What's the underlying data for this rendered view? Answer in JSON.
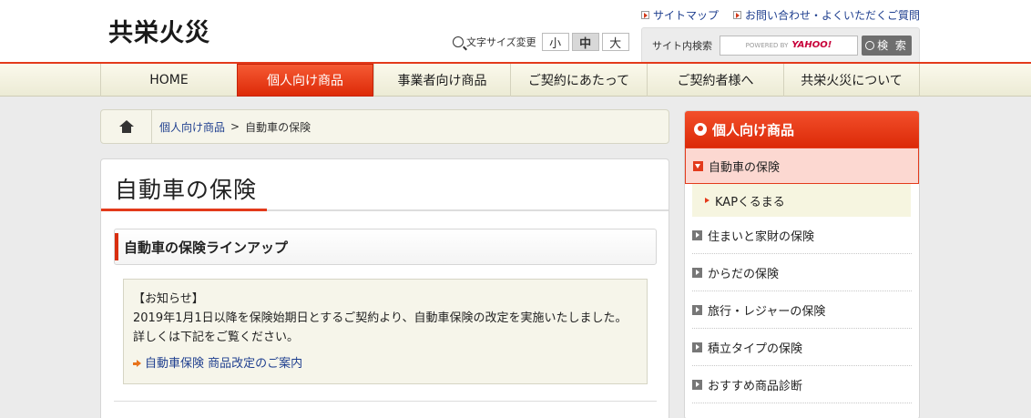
{
  "header": {
    "logo": "共栄火災",
    "top_links": [
      "サイトマップ",
      "お問い合わせ・よくいただくご質問"
    ],
    "font_size_label": "文字サイズ変更",
    "font_sizes": [
      "小",
      "中",
      "大"
    ],
    "font_size_selected": "中",
    "search_label": "サイト内検索",
    "search_powered": "POWERED BY",
    "search_brand": "YAHOO!",
    "search_button": "検 索"
  },
  "nav": {
    "items": [
      "HOME",
      "個人向け商品",
      "事業者向け商品",
      "ご契約にあたって",
      "ご契約者様へ",
      "共栄火災について"
    ],
    "active": "個人向け商品"
  },
  "breadcrumb": {
    "link": "個人向け商品",
    "separator": ">",
    "current": "自動車の保険"
  },
  "main": {
    "title": "自動車の保険",
    "section_heading": "自動車の保険ラインアップ",
    "notice": {
      "heading": "【お知らせ】",
      "body": "2019年1月1日以降を保険始期日とするご契約より、自動車保険の改定を実施いたしました。詳しくは下記をご覧ください。",
      "link": "自動車保険 商品改定のご案内"
    }
  },
  "sidebar": {
    "heading": "個人向け商品",
    "current": "自動車の保険",
    "sub": "KAPくるまる",
    "items": [
      "住まいと家財の保険",
      "からだの保険",
      "旅行・レジャーの保険",
      "積立タイプの保険",
      "おすすめ商品診断"
    ]
  },
  "colors": {
    "accent": "#e33a1b",
    "link": "#1f3f8f",
    "nav_bg": "#f4f2e0"
  }
}
